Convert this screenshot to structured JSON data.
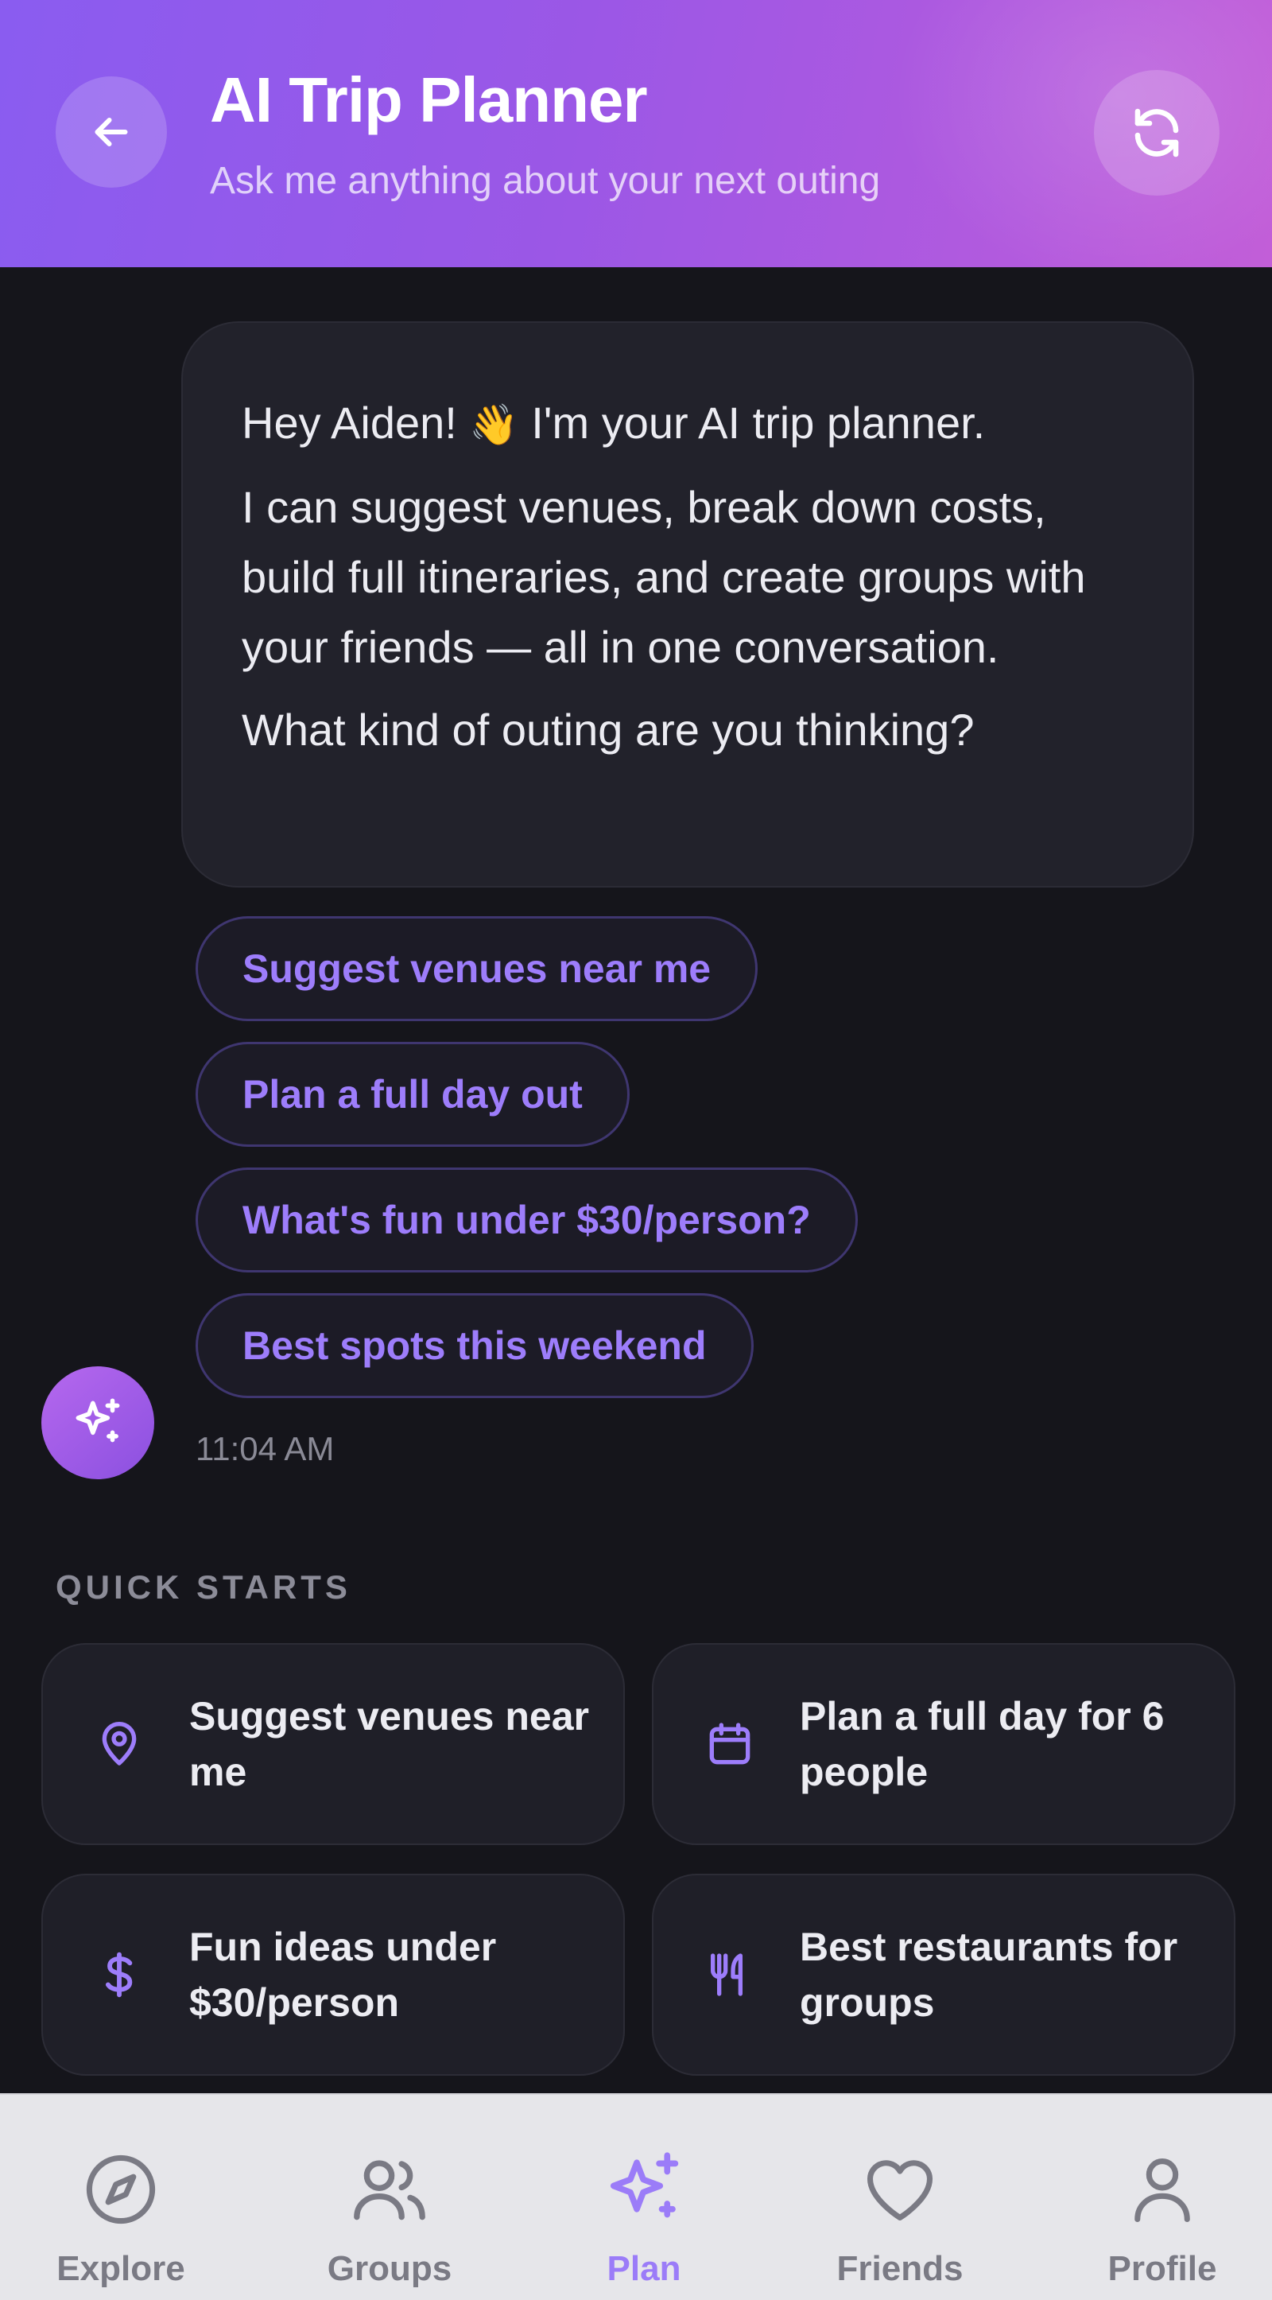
{
  "header": {
    "title": "AI Trip Planner",
    "subtitle": "Ask me anything about your next outing",
    "back_icon": "arrow-left-icon",
    "refresh_icon": "refresh-icon"
  },
  "chat": {
    "message": {
      "greeting": "Hey Aiden!",
      "wave": "👋",
      "greeting_rest": "I'm your AI trip planner.",
      "body": "I can suggest venues, break down costs, build full itineraries, and create groups with your friends — all in one conversation.",
      "question": "What kind of outing are you thinking?"
    },
    "suggestions": [
      "Suggest venues near me",
      "Plan a full day out",
      "What's fun under $30/person?",
      "Best spots this weekend"
    ],
    "avatar_icon": "sparkles-icon",
    "timestamp": "11:04 AM"
  },
  "quick_starts": {
    "label": "QUICK STARTS",
    "cards": [
      {
        "icon": "map-pin-icon",
        "text": "Suggest venues near me"
      },
      {
        "icon": "calendar-icon",
        "text": "Plan a full day for 6 people"
      },
      {
        "icon": "dollar-icon",
        "text": "Fun ideas under $30/person"
      },
      {
        "icon": "utensils-icon",
        "text": "Best restaurants for groups"
      }
    ]
  },
  "nav": {
    "active": "Plan",
    "items": [
      {
        "label": "Explore",
        "icon": "compass-icon"
      },
      {
        "label": "Groups",
        "icon": "users-icon"
      },
      {
        "label": "Plan",
        "icon": "sparkles-icon"
      },
      {
        "label": "Friends",
        "icon": "heart-icon"
      },
      {
        "label": "Profile",
        "icon": "user-icon"
      }
    ]
  },
  "colors": {
    "accent": "#9d7dfb",
    "header_start": "#8a5cf0",
    "header_end": "#c25ed8",
    "background": "#15151b",
    "card": "#1f1f28",
    "nav_background": "#e6e6ea"
  }
}
